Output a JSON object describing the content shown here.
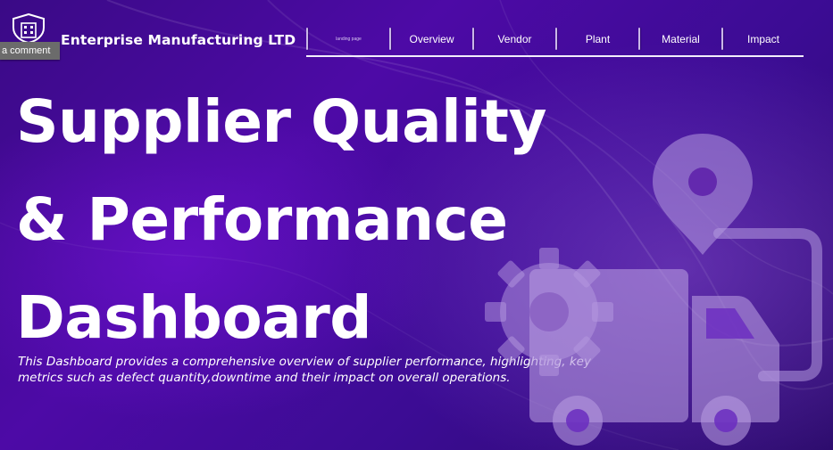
{
  "header": {
    "company_name": "Enterprise Manufacturing LTD",
    "logo_icon": "building-shield-icon",
    "tooltip": "a comment"
  },
  "nav": {
    "items": [
      {
        "label": "landing page"
      },
      {
        "label": "Overview"
      },
      {
        "label": "Vendor"
      },
      {
        "label": "Plant"
      },
      {
        "label": "Material"
      },
      {
        "label": "Impact"
      }
    ]
  },
  "hero": {
    "title_lines": [
      "Supplier Quality",
      "& Performance",
      "Dashboard"
    ],
    "description": "This Dashboard provides a comprehensive overview of supplier performance, highlighting, key metrics such as defect quantity,downtime and their impact on overall operations."
  },
  "illustration": {
    "icons": [
      "location-pin-icon",
      "gear-icon",
      "delivery-truck-icon"
    ]
  },
  "colors": {
    "background": "#4d0aa6",
    "text": "#ffffff",
    "illustration": "#b59ae0"
  }
}
